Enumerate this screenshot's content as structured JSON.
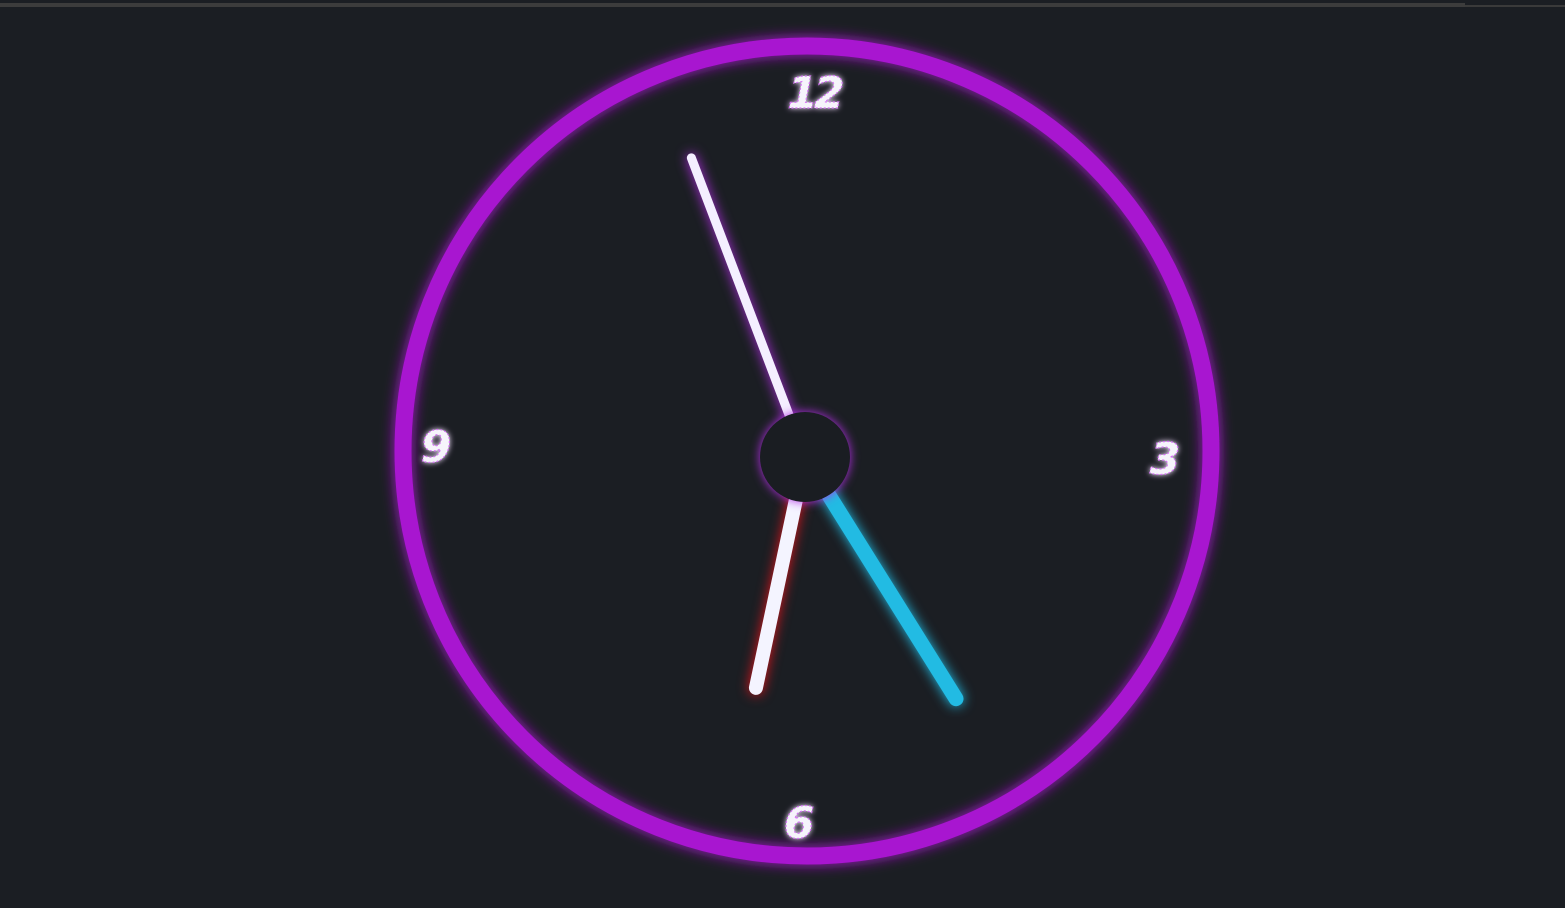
{
  "clock": {
    "numerals": {
      "twelve": "12",
      "three": "3",
      "six": "6",
      "nine": "9"
    },
    "time": {
      "hour": 4,
      "minute": 56,
      "second": 32
    },
    "colors": {
      "background": "#1b1e23",
      "face": "#1b1e23",
      "ring": "#a814d0",
      "ring_glow": "#c73cf0",
      "numeral_fill": "#f6f4fb",
      "numeral_glow": "#d56ff5",
      "hour_hand": "#22bbe3",
      "minute_hand": "#f4efff",
      "minute_glow": "#b52ee8",
      "second_hand": "#f4f4ff",
      "second_glow": "#e0141c",
      "center_cap": "#1a1d22"
    },
    "icons": {
      "center": "center-cap-icon"
    }
  }
}
